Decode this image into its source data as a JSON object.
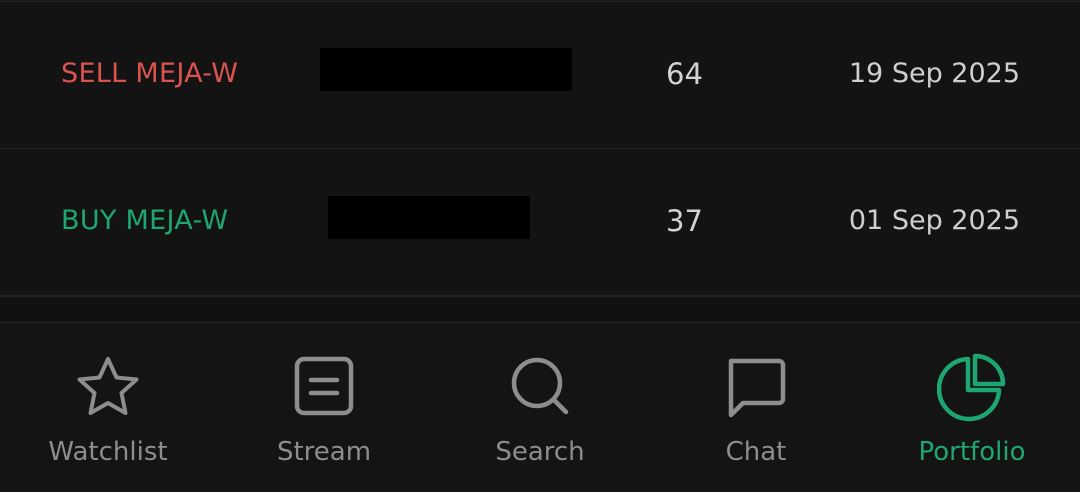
{
  "transactions": [
    {
      "action": "SELL MEJA-W",
      "side": "sell",
      "quantity": "64",
      "date": "19 Sep 2025"
    },
    {
      "action": "BUY MEJA-W",
      "side": "buy",
      "quantity": "37",
      "date": "01 Sep 2025"
    }
  ],
  "nav": {
    "items": [
      {
        "label": "Watchlist",
        "icon": "star-icon"
      },
      {
        "label": "Stream",
        "icon": "stream-icon"
      },
      {
        "label": "Search",
        "icon": "search-icon"
      },
      {
        "label": "Chat",
        "icon": "chat-icon"
      },
      {
        "label": "Portfolio",
        "icon": "pie-chart-icon",
        "active": true
      }
    ]
  },
  "colors": {
    "sell": "#d9534f",
    "buy": "#1ea672",
    "accent": "#1ea672",
    "inactive": "#8d8d8d",
    "background": "#131313"
  }
}
